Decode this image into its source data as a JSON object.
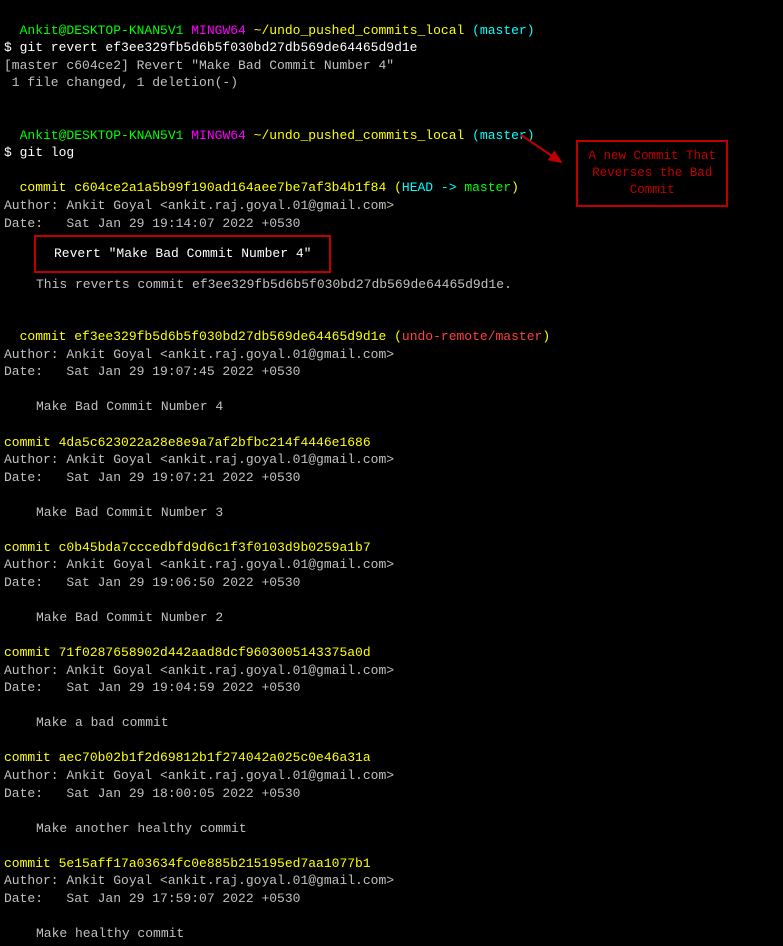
{
  "prompt1": {
    "user": "Ankit@DESKTOP-KNAN5V1",
    "shell": "MINGW64",
    "path": "~/undo_pushed_commits_local",
    "branch": "(master)",
    "cmd": "$ git revert ef3ee329fb5d6b5f030bd27db569de64465d9d1e",
    "out1": "[master c604ce2] Revert \"Make Bad Commit Number 4\"",
    "out2": " 1 file changed, 1 deletion(-)"
  },
  "prompt2": {
    "user": "Ankit@DESKTOP-KNAN5V1",
    "shell": "MINGW64",
    "path": "~/undo_pushed_commits_local",
    "branch": "(master)",
    "cmd": "$ git log"
  },
  "commits": [
    {
      "hash": "commit c604ce2a1a5b99f190ad164aee7be7af3b4b1f84",
      "ref_open": " (",
      "ref_head": "HEAD -> ",
      "ref_branch": "master",
      "ref_close": ")",
      "author": "Author: Ankit Goyal <ankit.raj.goyal.01@gmail.com>",
      "date": "Date:   Sat Jan 29 19:14:07 2022 +0530",
      "msg_boxed": "Revert \"Make Bad Commit Number 4\"",
      "msg2": "This reverts commit ef3ee329fb5d6b5f030bd27db569de64465d9d1e."
    },
    {
      "hash": "commit ef3ee329fb5d6b5f030bd27db569de64465d9d1e",
      "ref_open": " (",
      "ref_remote": "undo-remote/master",
      "ref_close": ")",
      "author": "Author: Ankit Goyal <ankit.raj.goyal.01@gmail.com>",
      "date": "Date:   Sat Jan 29 19:07:45 2022 +0530",
      "msg": "Make Bad Commit Number 4"
    },
    {
      "hash": "commit 4da5c623022a28e8e9a7af2bfbc214f4446e1686",
      "author": "Author: Ankit Goyal <ankit.raj.goyal.01@gmail.com>",
      "date": "Date:   Sat Jan 29 19:07:21 2022 +0530",
      "msg": "Make Bad Commit Number 3"
    },
    {
      "hash": "commit c0b45bda7cccedbfd9d6c1f3f0103d9b0259a1b7",
      "author": "Author: Ankit Goyal <ankit.raj.goyal.01@gmail.com>",
      "date": "Date:   Sat Jan 29 19:06:50 2022 +0530",
      "msg": "Make Bad Commit Number 2"
    },
    {
      "hash": "commit 71f0287658902d442aad8dcf9603005143375a0d",
      "author": "Author: Ankit Goyal <ankit.raj.goyal.01@gmail.com>",
      "date": "Date:   Sat Jan 29 19:04:59 2022 +0530",
      "msg": "Make a bad commit"
    },
    {
      "hash": "commit aec70b02b1f2d69812b1f274042a025c0e46a31a",
      "author": "Author: Ankit Goyal <ankit.raj.goyal.01@gmail.com>",
      "date": "Date:   Sat Jan 29 18:00:05 2022 +0530",
      "msg": "Make another healthy commit"
    },
    {
      "hash": "commit 5e15aff17a03634fc0e885b215195ed7aa1077b1",
      "author": "Author: Ankit Goyal <ankit.raj.goyal.01@gmail.com>",
      "date": "Date:   Sat Jan 29 17:59:07 2022 +0530",
      "msg": "Make healthy commit"
    }
  ],
  "annotation": {
    "line1": "A new Commit That",
    "line2": "Reverses the Bad",
    "line3": "Commit"
  }
}
